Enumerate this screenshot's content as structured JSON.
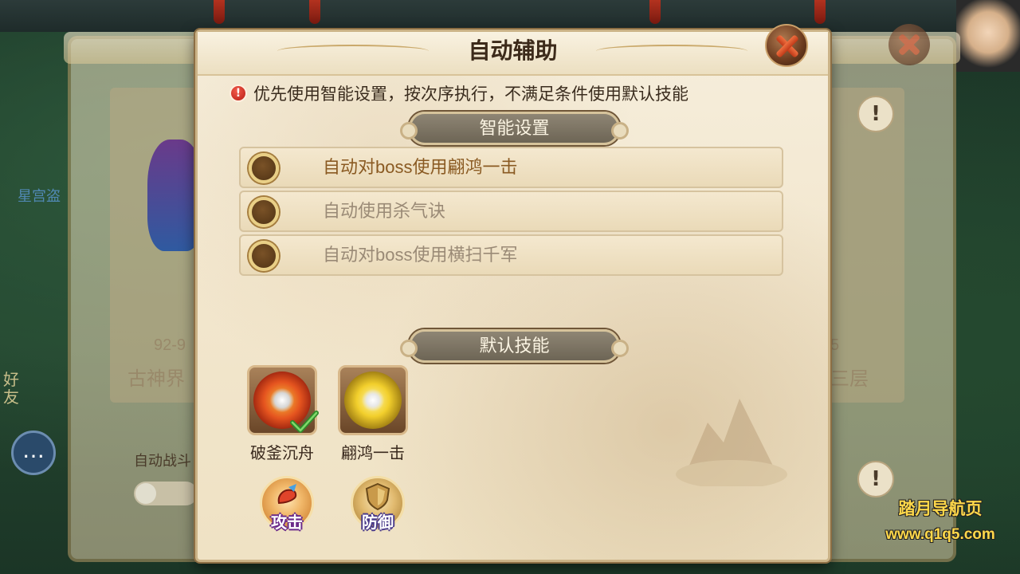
{
  "dialog": {
    "title": "自动辅助",
    "notice": "优先使用智能设置，按次序执行，不满足条件使用默认技能"
  },
  "smart_settings": {
    "heading": "智能设置",
    "options": [
      {
        "label": "自动对boss使用翩鸿一击",
        "label_color": "#8a5a22"
      },
      {
        "label": "自动使用杀气诀",
        "label_color": "#9a8a76"
      },
      {
        "label": "自动对boss使用横扫千军",
        "label_color": "#9a8a76"
      }
    ]
  },
  "default_skills": {
    "heading": "默认技能",
    "skills": [
      {
        "name": "破釜沉舟",
        "icon": "broken-cauldron-skill-icon",
        "selected": true
      },
      {
        "name": "翩鸿一击",
        "icon": "soaring-swan-strike-skill-icon",
        "selected": false
      }
    ],
    "actions": [
      {
        "label": "攻击",
        "icon": "attack-icon"
      },
      {
        "label": "防御",
        "icon": "defend-shield-icon"
      }
    ]
  },
  "background": {
    "left_card_range": "92-9",
    "left_card_name": "古神界",
    "right_card_name": "三层",
    "right_card_num": "5",
    "auto_battle_label": "自动战斗",
    "side_text_1": "星宫盗",
    "side_text_2": "好友"
  },
  "watermark": {
    "title": "踏月导航页",
    "url": "www.q1q5.com"
  },
  "colors": {
    "accent": "#8a5a22",
    "panel": "#f2e6cd",
    "banner": "#7d7565",
    "watermark": "#ffd84a"
  }
}
